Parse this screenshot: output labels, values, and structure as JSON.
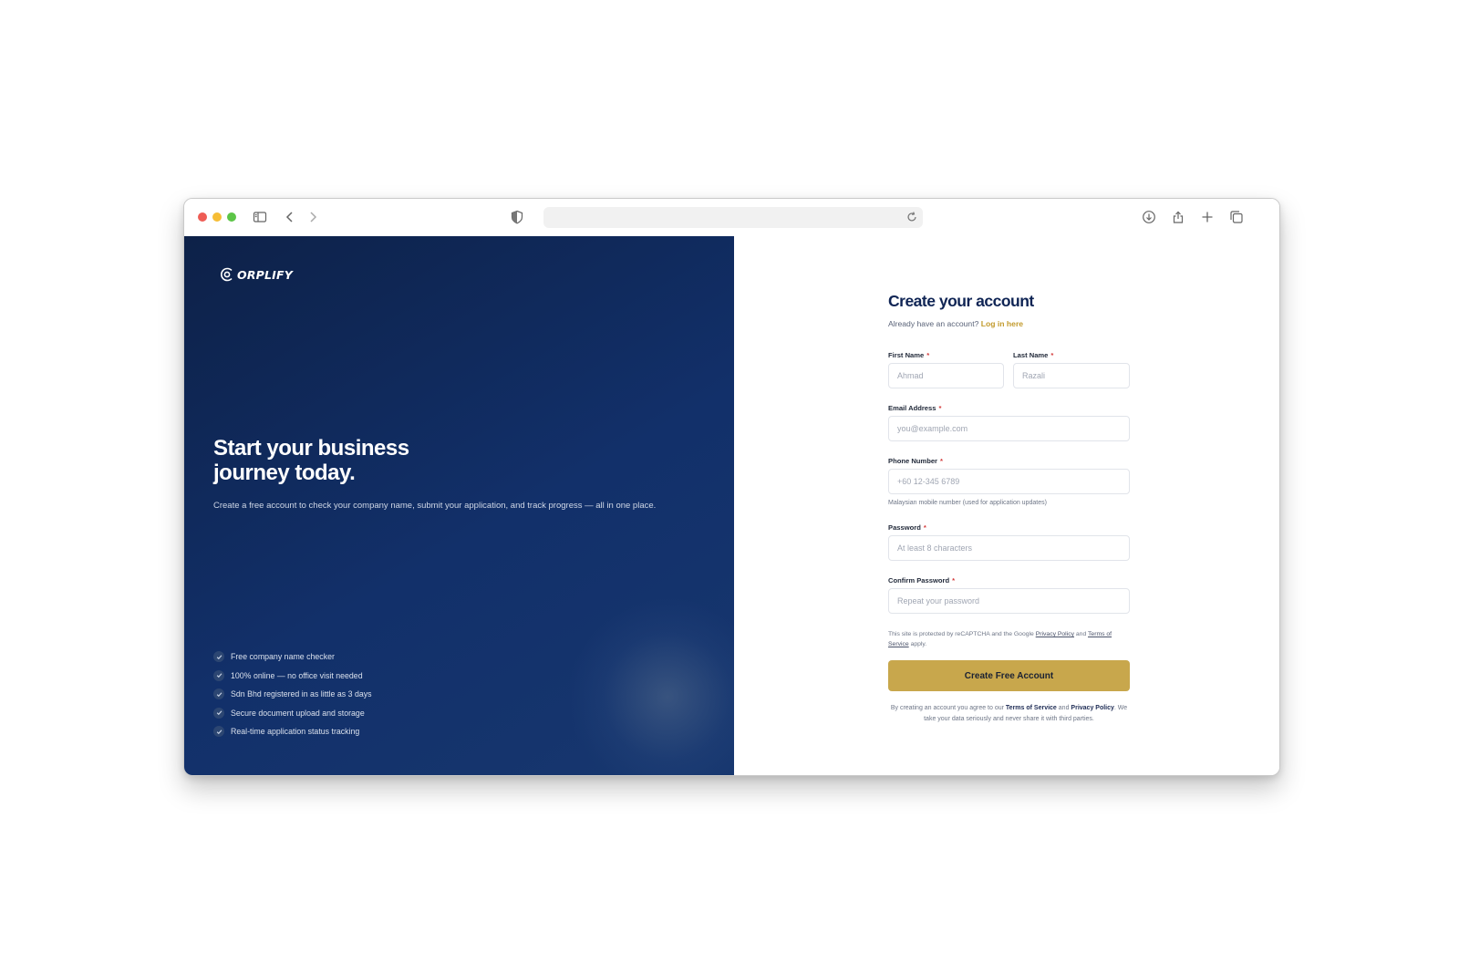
{
  "browser": {
    "url": "",
    "icons": [
      "sidebar-icon",
      "back-icon",
      "forward-icon",
      "shield-icon",
      "reload-icon",
      "download-icon",
      "share-icon",
      "new-tab-icon",
      "tabs-overview-icon"
    ]
  },
  "hero": {
    "logo_text": "ORPLIFY",
    "title_line1": "Start your business",
    "title_line2": "journey today.",
    "subtitle": "Create a free account to check your company name, submit your application, and track progress — all in one place.",
    "features": [
      "Free company name checker",
      "100% online — no office visit needed",
      "Sdn Bhd registered in as little as 3 days",
      "Secure document upload and storage",
      "Real-time application status tracking"
    ]
  },
  "form": {
    "title": "Create your account",
    "login_prompt": "Already have an account?",
    "login_link": "Log in here",
    "first_name": {
      "label": "First Name",
      "placeholder": "Ahmad"
    },
    "last_name": {
      "label": "Last Name",
      "placeholder": "Razali"
    },
    "email": {
      "label": "Email Address",
      "placeholder": "you@example.com"
    },
    "phone": {
      "label": "Phone Number",
      "placeholder": "+60 12-345 6789",
      "hint": "Malaysian mobile number (used for application updates)"
    },
    "password": {
      "label": "Password",
      "placeholder": "At least 8 characters"
    },
    "confirm_password": {
      "label": "Confirm Password",
      "placeholder": "Repeat your password"
    },
    "required_mark": "*",
    "recaptcha": {
      "prefix": "This site is protected by reCAPTCHA and the Google",
      "privacy": "Privacy Policy",
      "and": "and",
      "terms": "Terms of Service",
      "suffix": "apply."
    },
    "submit_label": "Create Free Account",
    "agreement": {
      "prefix": "By creating an account you agree to our",
      "terms": "Terms of Service",
      "and": "and",
      "privacy": "Privacy Policy",
      "suffix": ". We take your data seriously and never share it with third parties."
    }
  },
  "colors": {
    "accent_gold": "#c8a74c",
    "navy": "#0f2454",
    "required_red": "#d33a3a"
  }
}
